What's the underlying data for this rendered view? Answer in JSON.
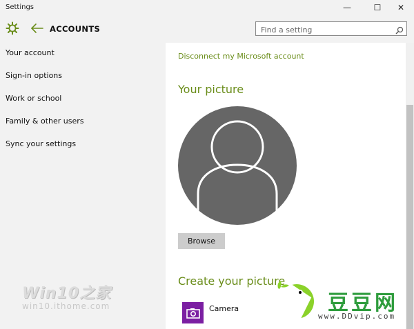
{
  "window": {
    "title": "Settings",
    "minimize": "—",
    "maximize": "☐",
    "close": "✕"
  },
  "header": {
    "title": "ACCOUNTS",
    "search_placeholder": "Find a setting",
    "icons": [
      "gear-icon",
      "back-arrow-icon",
      "search-icon"
    ]
  },
  "sidebar": {
    "items": [
      {
        "label": "Your account"
      },
      {
        "label": "Sign-in options"
      },
      {
        "label": "Work or school"
      },
      {
        "label": "Family & other users"
      },
      {
        "label": "Sync your settings"
      }
    ]
  },
  "content": {
    "disconnect_link": "Disconnect my Microsoft account",
    "your_picture_heading": "Your picture",
    "browse_button": "Browse",
    "create_picture_heading": "Create your picture",
    "camera_label": "Camera"
  },
  "watermarks": {
    "left_brand": "Win10之家",
    "left_url": "win10.ithome.com",
    "right_brand": "豆豆网",
    "right_url": "www.DDvip.com"
  },
  "colors": {
    "accent": "#6a8d1a",
    "background": "#f2f2f2",
    "content_background": "#ffffff",
    "avatar": "#666666",
    "camera_tile": "#7b1fa2",
    "button": "#cccccc"
  }
}
